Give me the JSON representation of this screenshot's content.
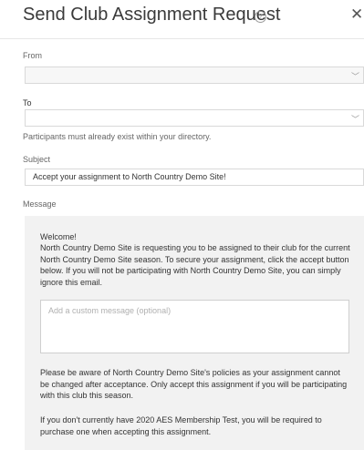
{
  "dialog": {
    "title": "Send Club Assignment Request",
    "help_icon": "question-circle-icon",
    "close_icon": "close-icon"
  },
  "form": {
    "from_label": "From",
    "from_value": "",
    "to_label": "To",
    "to_value": "",
    "to_hint": "Participants must already exist within your directory.",
    "subject_label": "Subject",
    "subject_value": "Accept your assignment to North Country Demo Site!",
    "message_label": "Message"
  },
  "message": {
    "greeting": "Welcome!",
    "body": "North Country Demo Site is requesting you to be assigned to their club for the current North Country Demo Site season. To secure your assignment, click the accept button below. If you will not be participating with North Country Demo Site, you can simply ignore this email.",
    "custom_placeholder": "Add a custom message (optional)",
    "policy": "Please be aware of North Country Demo Site's policies as your assignment cannot be changed after acceptance. Only accept this assignment if you will be participating with this club this season.",
    "membership": "If you don't currently have 2020 AES Membership Test, you will be required to purchase one when accepting this assignment."
  }
}
